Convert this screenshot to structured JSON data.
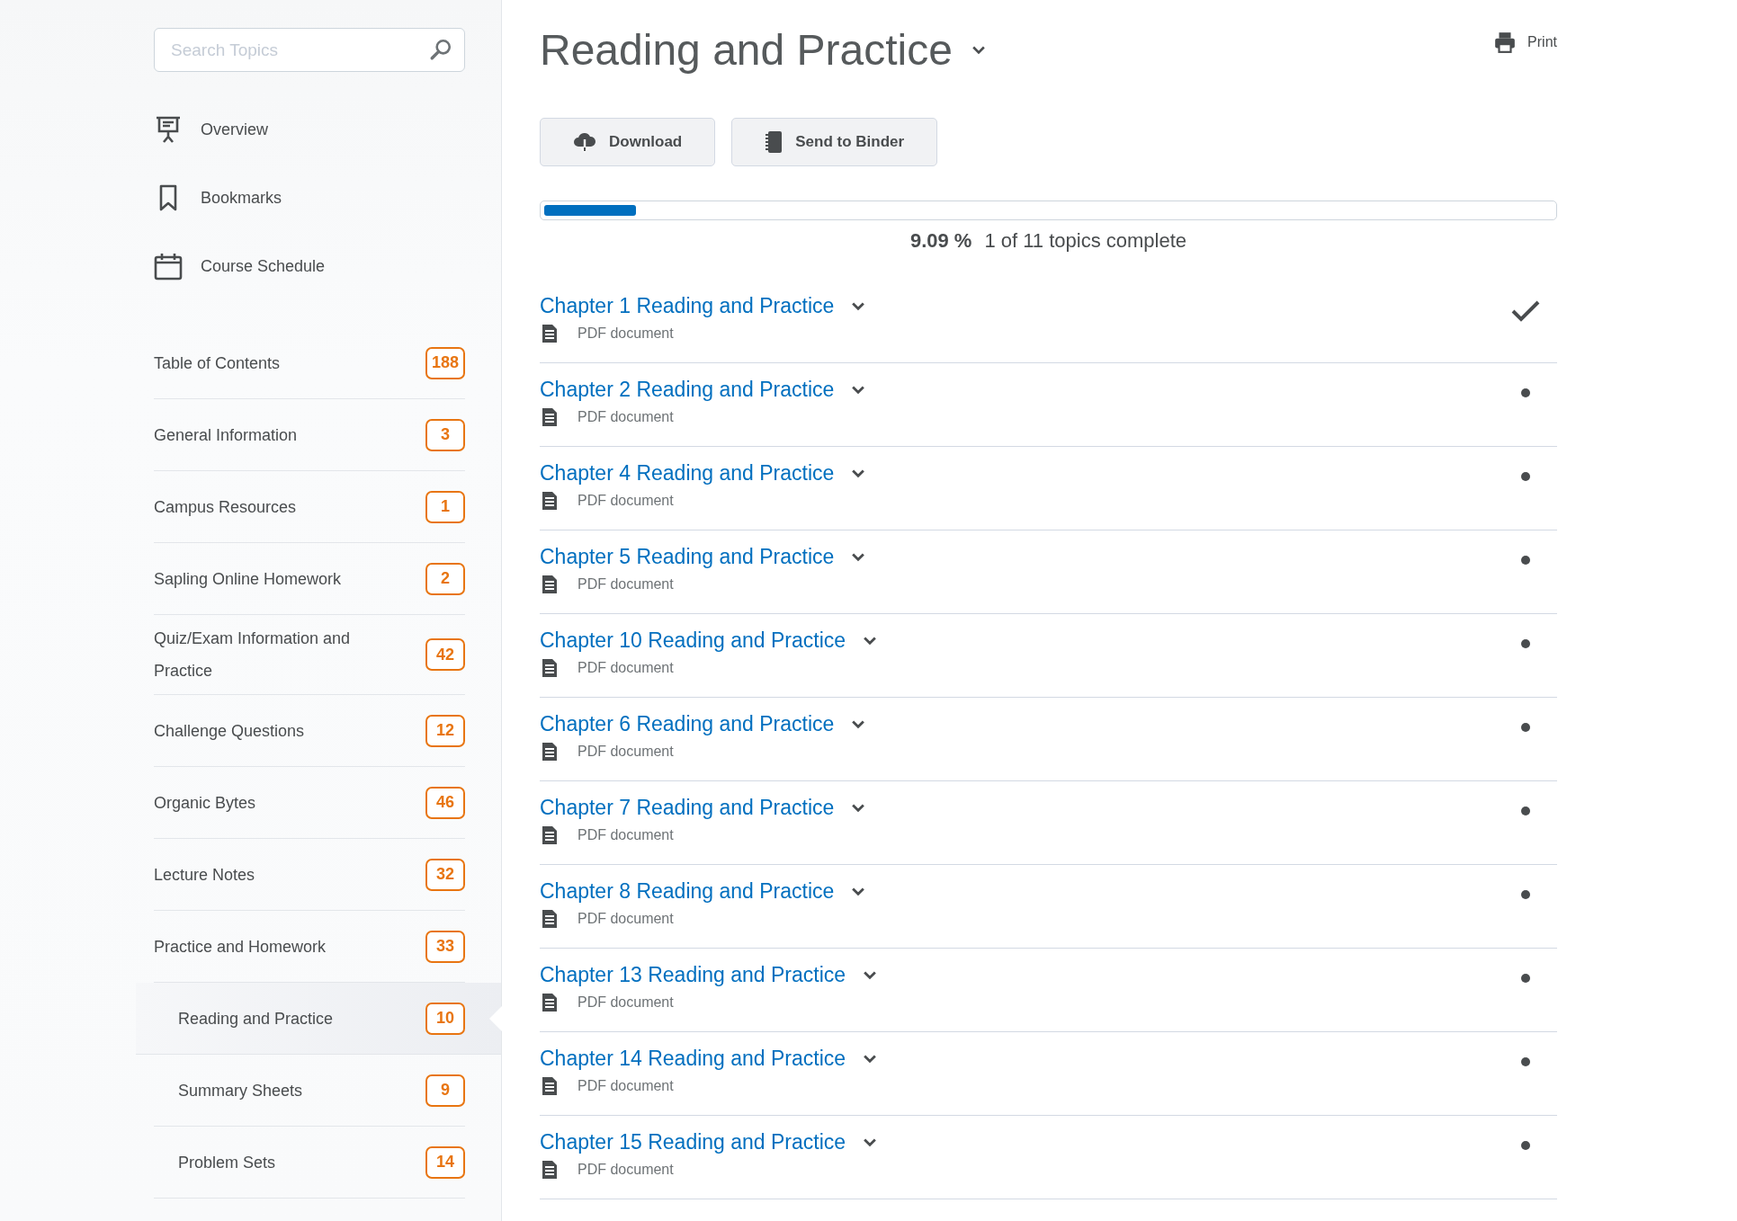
{
  "sidebar": {
    "search": {
      "placeholder": "Search Topics"
    },
    "nav": [
      {
        "label": "Overview",
        "kind": "overview"
      },
      {
        "label": "Bookmarks",
        "kind": "bookmarks"
      },
      {
        "label": "Course Schedule",
        "kind": "schedule"
      }
    ],
    "modules": [
      {
        "label": "Table of Contents",
        "count": "188",
        "selected": false
      },
      {
        "label": "General Information",
        "count": "3",
        "selected": false
      },
      {
        "label": "Campus Resources",
        "count": "1",
        "selected": false
      },
      {
        "label": "Sapling Online Homework",
        "count": "2",
        "selected": false
      },
      {
        "label": "Quiz/Exam Information and Practice",
        "count": "42",
        "selected": false
      },
      {
        "label": "Challenge Questions",
        "count": "12",
        "selected": false
      },
      {
        "label": "Organic Bytes",
        "count": "46",
        "selected": false
      },
      {
        "label": "Lecture Notes",
        "count": "32",
        "selected": false
      },
      {
        "label": "Practice and Homework",
        "count": "33",
        "selected": false,
        "children": [
          {
            "label": "Reading and Practice",
            "count": "10",
            "selected": true
          },
          {
            "label": "Summary Sheets",
            "count": "9",
            "selected": false
          },
          {
            "label": "Problem Sets",
            "count": "14",
            "selected": false
          }
        ]
      }
    ]
  },
  "header": {
    "title": "Reading and Practice",
    "print": "Print"
  },
  "actions": [
    {
      "label": "Download",
      "kind": "download"
    },
    {
      "label": "Send to Binder",
      "kind": "binder"
    }
  ],
  "progress": {
    "level": 0.0909,
    "percent": "9.09 %",
    "summary": "1 of 11 topics complete"
  },
  "topics": [
    {
      "title": "Chapter 1 Reading and Practice",
      "type": "PDF document",
      "completed": true
    },
    {
      "title": "Chapter 2 Reading and Practice",
      "type": "PDF document",
      "completed": false
    },
    {
      "title": "Chapter 4 Reading and Practice",
      "type": "PDF document",
      "completed": false
    },
    {
      "title": "Chapter 5 Reading and Practice",
      "type": "PDF document",
      "completed": false
    },
    {
      "title": "Chapter 10 Reading and Practice",
      "type": "PDF document",
      "completed": false
    },
    {
      "title": "Chapter 6 Reading and Practice",
      "type": "PDF document",
      "completed": false
    },
    {
      "title": "Chapter 7 Reading and Practice",
      "type": "PDF document",
      "completed": false
    },
    {
      "title": "Chapter 8 Reading and Practice",
      "type": "PDF document",
      "completed": false
    },
    {
      "title": "Chapter 13 Reading and Practice",
      "type": "PDF document",
      "completed": false
    },
    {
      "title": "Chapter 14 Reading and Practice",
      "type": "PDF document",
      "completed": false
    },
    {
      "title": "Chapter 15 Reading and Practice",
      "type": "PDF document",
      "completed": false
    }
  ]
}
